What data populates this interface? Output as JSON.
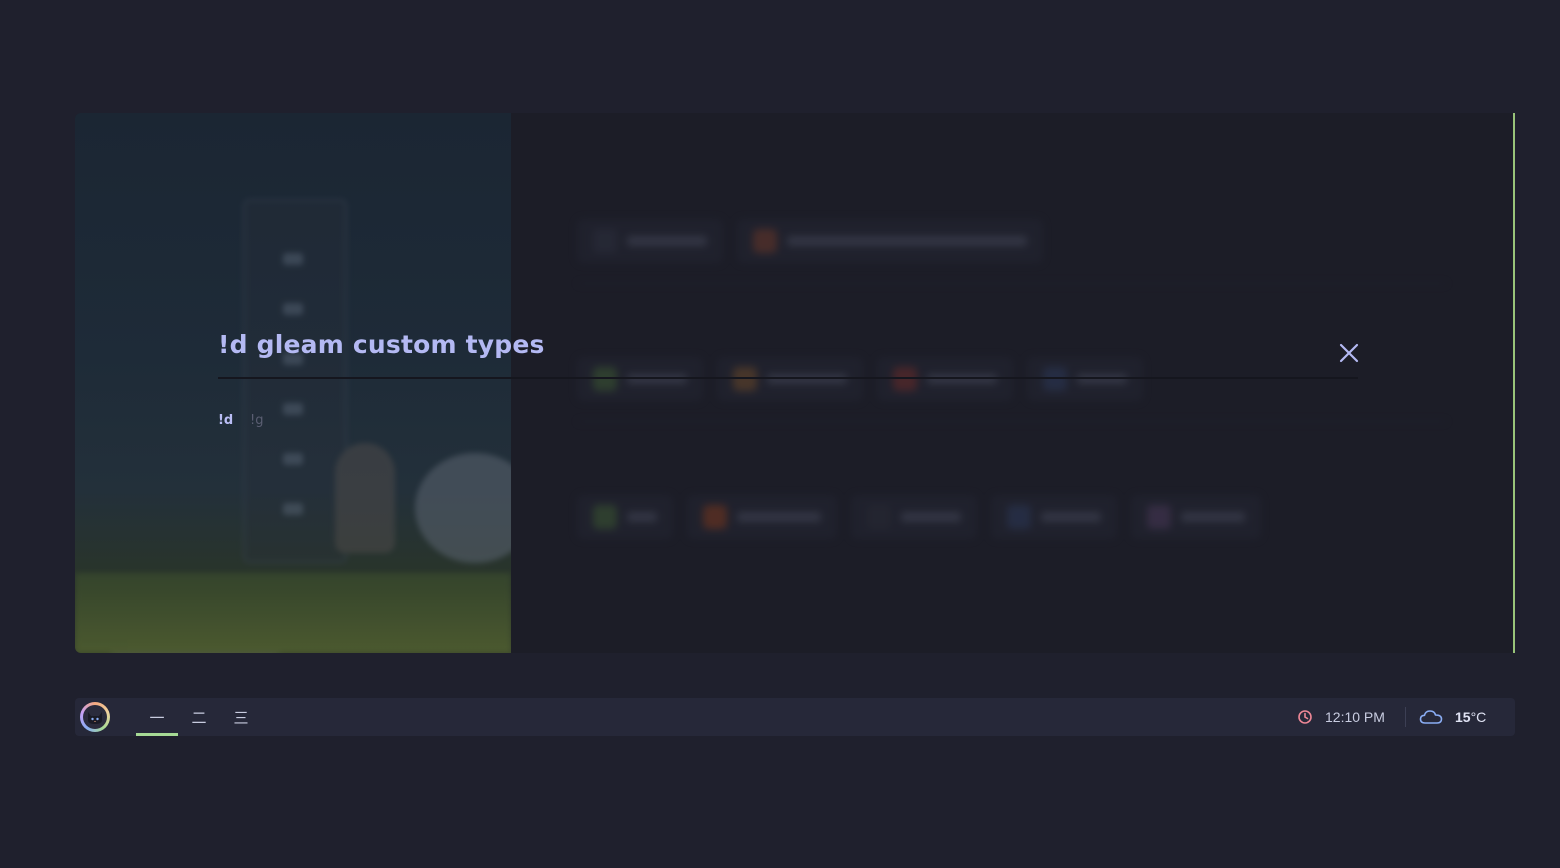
{
  "search": {
    "query": "!d gleam custom types",
    "bangs": [
      "!d",
      "!g"
    ]
  },
  "colors": {
    "accent": "#98c379",
    "query_text": "#b4b9f3",
    "bar_bg": "#262839",
    "page_bg": "#1f202d"
  },
  "icons": {
    "close": "close-icon",
    "clock": "clock-icon",
    "weather": "cloud-icon",
    "avatar": "cat-avatar-icon"
  },
  "bar": {
    "workspaces": [
      "一",
      "二",
      "三"
    ],
    "active_workspace": 0,
    "time": "12:10 PM",
    "temperature_value": "15",
    "temperature_unit": "°C"
  }
}
